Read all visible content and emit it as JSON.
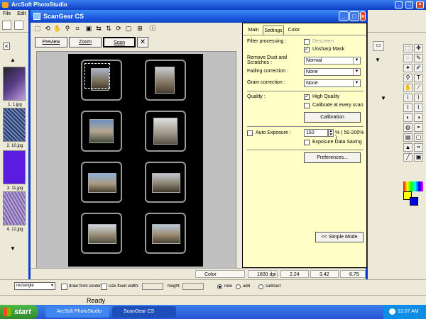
{
  "app": {
    "title": "ArcSoft PhotoStudio",
    "menu": [
      "File",
      "Edit"
    ]
  },
  "thumbs": [
    "1. 1.jpg",
    "2. 10.jpg",
    "3. 11.jpg",
    "4. 12.jpg"
  ],
  "scangear": {
    "title": "ScanGear CS",
    "actions": {
      "preview": "Preview",
      "zoom": "Zoom",
      "scan": "Scan"
    },
    "tabs": [
      "Main",
      "Settings",
      "Color"
    ],
    "settings": {
      "filter_processing": "Filter processing :",
      "descreen": "Descreen",
      "unsharp_mask": "Unsharp Mask",
      "remove_dust": "Remove Dust and Scratches :",
      "remove_dust_value": "Normal",
      "fading": "Fading correction :",
      "fading_value": "None",
      "grain": "Grain correction :",
      "grain_value": "None",
      "quality": "Quality :",
      "high_quality": "High Quality",
      "calibrate": "Calibrate at every scan",
      "calibration_btn": "Calibration",
      "auto_exposure": "Auto Exposure :",
      "exposure_value": "150",
      "exposure_range": "% ( 50-200% )",
      "exposure_saving": "Exposure Data Saving",
      "preferences_btn": "Preferences...",
      "simple_mode_btn": "<< Simple Mode"
    },
    "status": {
      "mode": "Color",
      "dpi": "1600 dpi",
      "w": "2.24",
      "h": "3.42",
      "size": "8.75 MB"
    }
  },
  "options": {
    "shape": "rectangle",
    "draw_from_center": "draw from center",
    "size_fixed": "size fixed",
    "width": "width:",
    "height": "height:",
    "new": "new",
    "add": "add",
    "subtract": "subtract"
  },
  "status_ready": "Ready",
  "taskbar": {
    "start": "start",
    "tasks": [
      "ArcSoft PhotoStudio",
      "ScanGear CS"
    ],
    "time": "12:07 AM"
  }
}
